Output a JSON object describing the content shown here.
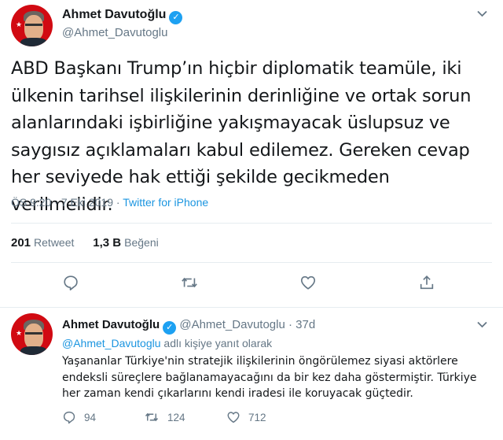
{
  "main_tweet": {
    "display_name": "Ahmet Davutoğlu",
    "handle": "@Ahmet_Davutoglu",
    "text": "ABD Başkanı Trump’ın hiçbir diplomatik teamüle, iki ülkenin tarihsel ilişkilerinin derinliğine ve ortak sorun alanlarındaki işbirliğine yakışmayacak üslupsuz ve saygısız açıklamaları kabul edilemez. Gereken cevap her seviyede hak ettiği şekilde gecikmeden verilmelidir.",
    "time": "ÖS 9:20",
    "separator": "·",
    "date": "7 Eki 2019",
    "source": "Twitter for iPhone",
    "retweet_count": "201",
    "retweet_label": "Retweet",
    "like_count": "1,3 B",
    "like_label": "Beğeni"
  },
  "reply_tweet": {
    "display_name": "Ahmet Davutoğlu",
    "handle": "@Ahmet_Davutoglu",
    "separator": "·",
    "age": "37d",
    "reply_to_mention": "@Ahmet_Davutoglu",
    "reply_to_suffix": "adlı kişiye yanıt olarak",
    "text": "Yaşananlar Türkiye'nin stratejik ilişkilerinin öngörülemez siyasi aktörlere endeksli süreçlere bağlanamayacağını da bir kez daha göstermiştir. Türkiye her zaman kendi çıkarlarını kendi iradesi ile koruyacak güçtedir.",
    "reply_count": "94",
    "retweet_count": "124",
    "like_count": "712"
  },
  "icons": [
    "reply-icon",
    "retweet-icon",
    "like-icon",
    "share-icon",
    "verified-badge-icon",
    "chevron-down-icon"
  ],
  "colors": {
    "accent": "#1da1f2",
    "link": "#1b95e0",
    "muted": "#657786",
    "text": "#14171a",
    "divider": "#e6ecf0"
  }
}
